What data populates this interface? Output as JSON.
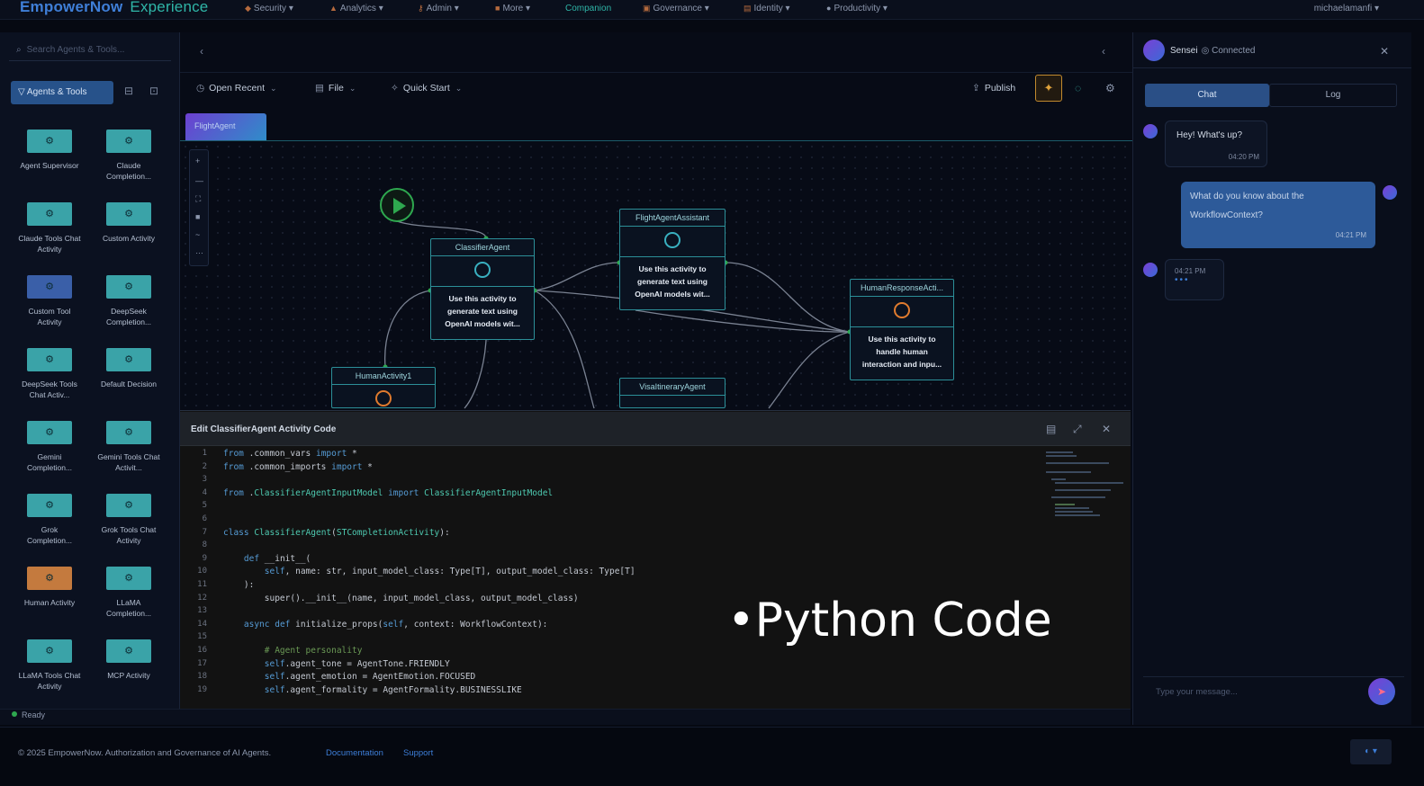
{
  "brand": {
    "name": "EmpowerNow",
    "suffix": "Experience"
  },
  "nav": [
    {
      "label": "Security",
      "icon": "shield-icon"
    },
    {
      "label": "Analytics",
      "icon": "chart-icon"
    },
    {
      "label": "Admin",
      "icon": "key-icon"
    },
    {
      "label": "More",
      "icon": "grid-icon"
    },
    {
      "label": "Companion",
      "icon": ""
    },
    {
      "label": "Governance",
      "icon": "building-icon"
    },
    {
      "label": "Identity",
      "icon": "id-icon"
    },
    {
      "label": "Productivity",
      "icon": "chat-icon"
    }
  ],
  "user": {
    "name": "michaelamanfi"
  },
  "sidebar": {
    "search_placeholder": "Search Agents & Tools...",
    "filter_label": "Agents & Tools",
    "tiles": [
      {
        "label": "Agent Supervisor",
        "color": "#3aa3a8"
      },
      {
        "label": "Claude Completion...",
        "color": "#3aa3a8"
      },
      {
        "label": "Claude Tools Chat Activity",
        "color": "#3aa3a8"
      },
      {
        "label": "Custom Activity",
        "color": "#3aa3a8"
      },
      {
        "label": "Custom Tool Activity",
        "color": "#3a5fa8"
      },
      {
        "label": "DeepSeek Completion...",
        "color": "#3aa3a8"
      },
      {
        "label": "DeepSeek Tools Chat Activ...",
        "color": "#3aa3a8"
      },
      {
        "label": "Default Decision",
        "color": "#3aa3a8"
      },
      {
        "label": "Gemini Completion...",
        "color": "#3aa3a8"
      },
      {
        "label": "Gemini Tools Chat Activit...",
        "color": "#3aa3a8"
      },
      {
        "label": "Grok Completion...",
        "color": "#3aa3a8"
      },
      {
        "label": "Grok Tools Chat Activity",
        "color": "#3aa3a8"
      },
      {
        "label": "Human Activity",
        "color": "#c47a3e"
      },
      {
        "label": "LLaMA Completion...",
        "color": "#3aa3a8"
      },
      {
        "label": "LLaMA Tools Chat Activity",
        "color": "#3aa3a8"
      },
      {
        "label": "MCP Activity",
        "color": "#3aa3a8"
      }
    ]
  },
  "toolbar": {
    "open_recent": "Open Recent",
    "file": "File",
    "quick_start": "Quick Start",
    "publish": "Publish"
  },
  "tab": {
    "label": "FlightAgent"
  },
  "nodes": {
    "classifier": {
      "title": "ClassifierAgent",
      "desc": "Use this activity to generate text using OpenAI models wit..."
    },
    "flight": {
      "title": "FlightAgentAssistant",
      "desc": "Use this activity to generate text using OpenAI models wit..."
    },
    "human_response": {
      "title": "HumanResponseActi...",
      "desc": "Use this activity to handle human interaction and inpu..."
    },
    "human1": {
      "title": "HumanActivity1"
    },
    "visa": {
      "title": "VisaItineraryAgent"
    }
  },
  "editor": {
    "title": "Edit ClassifierAgent Activity Code",
    "lines": [
      {
        "n": "1",
        "text": "from .common_vars import *"
      },
      {
        "n": "2",
        "text": "from .common_imports import *"
      },
      {
        "n": "3",
        "text": ""
      },
      {
        "n": "4",
        "text": "from .ClassifierAgentInputModel import ClassifierAgentInputModel"
      },
      {
        "n": "5",
        "text": ""
      },
      {
        "n": "6",
        "text": ""
      },
      {
        "n": "7",
        "text": "class ClassifierAgent(STCompletionActivity):"
      },
      {
        "n": "8",
        "text": ""
      },
      {
        "n": "9",
        "text": "    def __init__("
      },
      {
        "n": "10",
        "text": "        self, name: str, input_model_class: Type[T], output_model_class: Type[T]"
      },
      {
        "n": "11",
        "text": "    ):"
      },
      {
        "n": "12",
        "text": "        super().__init__(name, input_model_class, output_model_class)"
      },
      {
        "n": "13",
        "text": ""
      },
      {
        "n": "14",
        "text": "    async def initialize_props(self, context: WorkflowContext):"
      },
      {
        "n": "15",
        "text": ""
      },
      {
        "n": "16",
        "text": "        # Agent personality"
      },
      {
        "n": "17",
        "text": "        self.agent_tone = AgentTone.FRIENDLY"
      },
      {
        "n": "18",
        "text": "        self.agent_emotion = AgentEmotion.FOCUSED"
      },
      {
        "n": "19",
        "text": "        self.agent_formality = AgentFormality.BUSINESSLIKE"
      }
    ]
  },
  "overlay": {
    "bullet": "•",
    "text": "Python Code"
  },
  "status": {
    "text": "Ready"
  },
  "chat": {
    "name": "Sensei",
    "status": "Connected",
    "tabs": {
      "chat": "Chat",
      "log": "Log"
    },
    "messages": [
      {
        "from": "bot",
        "text": "Hey! What's up?",
        "time": "04:20 PM"
      },
      {
        "from": "user",
        "text": "What do you know about the WorkflowContext?",
        "time": "04:21 PM"
      },
      {
        "from": "bot",
        "text": "",
        "time": "04:21 PM",
        "typing": "•••"
      }
    ],
    "input_placeholder": "Type your message..."
  },
  "footer": {
    "copyright": "© 2025 EmpowerNow. Authorization and Governance of AI Agents.",
    "links": [
      "Documentation",
      "Support"
    ]
  }
}
